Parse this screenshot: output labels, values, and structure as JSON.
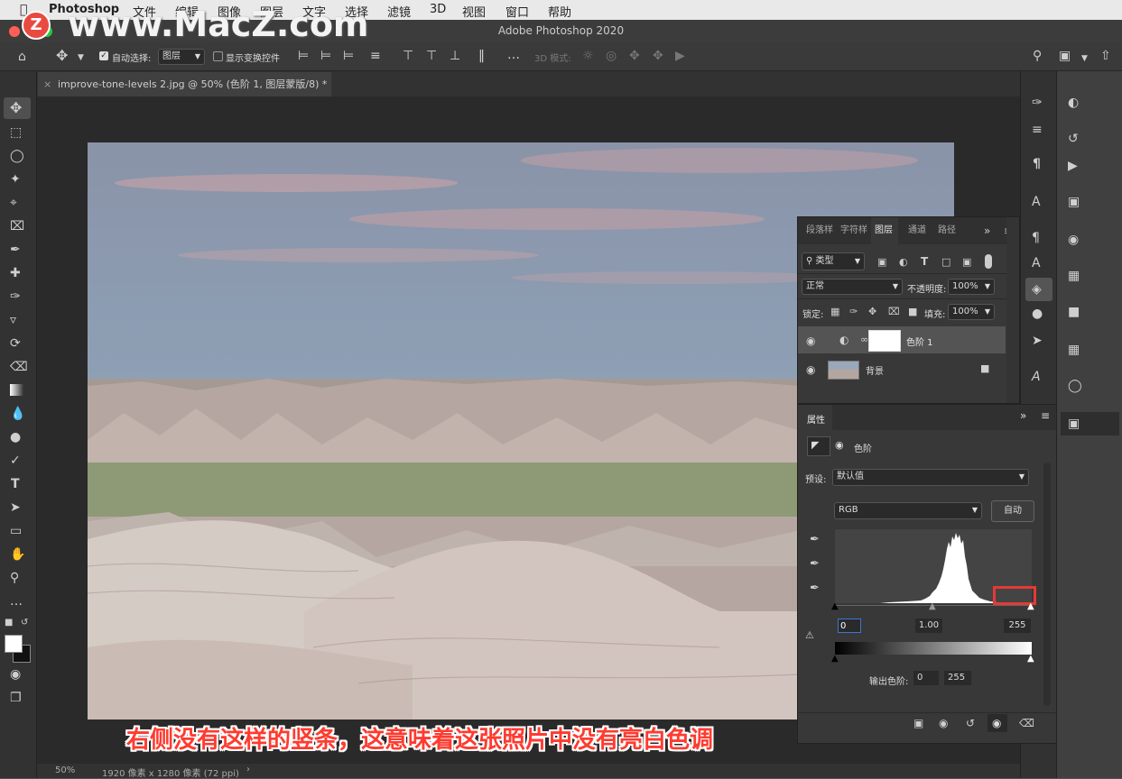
{
  "menubar": {
    "app": "Photoshop",
    "items": [
      "文件",
      "编辑",
      "图像",
      "图层",
      "文字",
      "选择",
      "滤镜",
      "3D",
      "视图",
      "窗口",
      "帮助"
    ]
  },
  "window": {
    "title": "Adobe Photoshop 2020"
  },
  "watermark": "www.MacZ.com",
  "options": {
    "auto_select_label": "自动选择:",
    "auto_select_value": "图层",
    "show_transform_label": "显示变换控件",
    "mode_3d_label": "3D 模式:"
  },
  "document": {
    "tab_title": "improve-tone-levels 2.jpg @ 50% (色阶 1, 图层蒙版/8) *"
  },
  "status": {
    "zoom": "50%",
    "info": "1920 像素 x 1280 像素 (72 ppi)"
  },
  "layers_panel": {
    "tabs": [
      "段落样",
      "字符样",
      "图层",
      "通道",
      "路径"
    ],
    "active_tab": "图层",
    "filter_label": "类型",
    "blend_mode": "正常",
    "opacity_label": "不透明度:",
    "opacity": "100%",
    "lock_label": "锁定:",
    "fill_label": "填充:",
    "fill": "100%",
    "layers": [
      {
        "name": "色阶 1"
      },
      {
        "name": "背景"
      }
    ]
  },
  "properties_panel": {
    "tab": "属性",
    "type_label": "色阶",
    "preset_label": "预设:",
    "preset_value": "默认值",
    "channel": "RGB",
    "auto_button": "自动",
    "input_black": "0",
    "input_gamma": "1.00",
    "input_white": "255",
    "output_label": "输出色阶:",
    "output_black": "0",
    "output_white": "255"
  },
  "caption": "右侧没有这样的竖条，这意味着这张照片中没有亮白色调",
  "colors": {
    "highlight_box": "#e53935",
    "caption_red": "#ff3b30"
  }
}
